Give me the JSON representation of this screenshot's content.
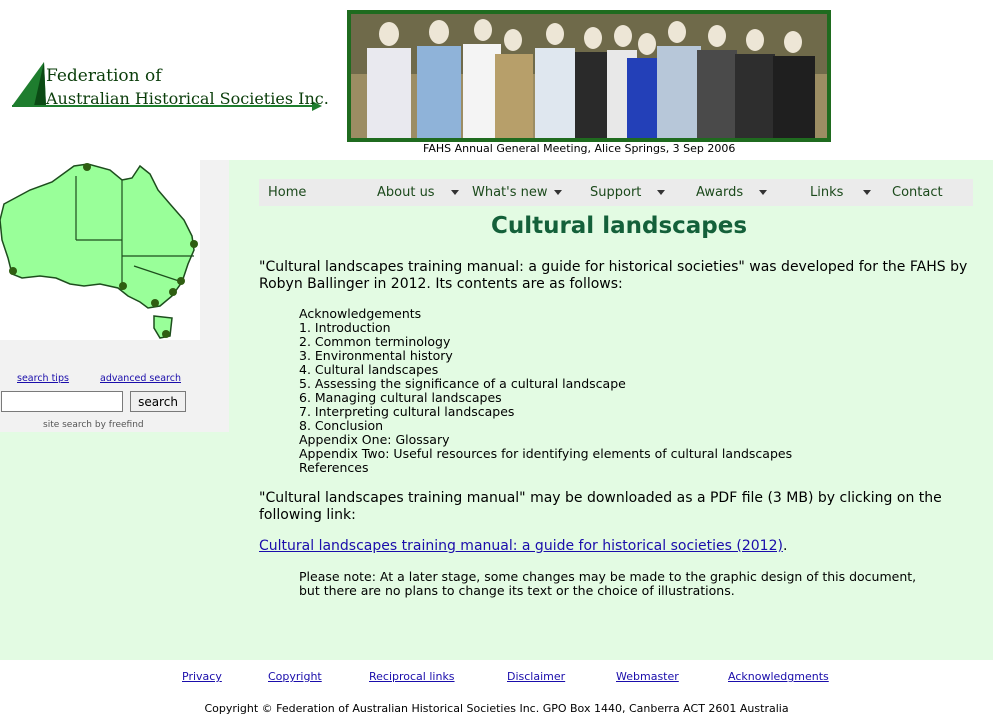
{
  "header": {
    "logo_line1": "Federation of",
    "logo_line2": "Australian Historical Societies Inc.",
    "photo_caption": "FAHS Annual General Meeting, Alice Springs, 3 Sep 2006"
  },
  "nav": {
    "items": [
      {
        "label": "Home",
        "has_dropdown": false
      },
      {
        "label": "About us",
        "has_dropdown": true
      },
      {
        "label": "What's new",
        "has_dropdown": true
      },
      {
        "label": "Support",
        "has_dropdown": true
      },
      {
        "label": "Awards",
        "has_dropdown": true
      },
      {
        "label": "Links",
        "has_dropdown": true
      },
      {
        "label": "Contact",
        "has_dropdown": false
      }
    ]
  },
  "sidebar": {
    "search_tips": "search tips",
    "advanced_search": "advanced search",
    "search_value": "",
    "search_button": "search",
    "credit_prefix": "site search by",
    "credit_brand": "freefind"
  },
  "main": {
    "title": "Cultural landscapes",
    "intro": "\"Cultural landscapes training manual: a guide for historical societies\" was developed for the FAHS by Robyn Ballinger in 2012. Its contents are as follows:",
    "contents": [
      "Acknowledgements",
      "1. Introduction",
      "2. Common terminology",
      "3. Environmental history",
      "4. Cultural landscapes",
      "5. Assessing the significance of a cultural landscape",
      "6. Managing cultural landscapes",
      "7. Interpreting cultural landscapes",
      "8. Conclusion",
      "Appendix One: Glossary",
      "Appendix Two: Useful resources for identifying elements of cultural landscapes",
      "References"
    ],
    "download_text": "\"Cultural landscapes training manual\" may be downloaded as a PDF file (3 MB) by clicking on the following link:",
    "download_link": "Cultural landscapes training manual: a guide for historical societies (2012)",
    "download_suffix": ".",
    "note": "Please note: At a later stage, some changes may be made to the graphic design of this document, but there are no plans to change its text or the choice of illustrations."
  },
  "footer": {
    "links": [
      "Privacy",
      "Copyright",
      "Reciprocal links",
      "Disclaimer",
      "Webmaster",
      "Acknowledgments"
    ],
    "copyright": "Copyright © Federation of Australian Historical Societies Inc. GPO Box 1440, Canberra ACT 2601 Australia"
  },
  "colors": {
    "band": "#e3fbe3",
    "title": "#14603a",
    "nav_bg": "#ebebeb",
    "map_fill": "#99ff99",
    "link": "#1a0dab"
  }
}
